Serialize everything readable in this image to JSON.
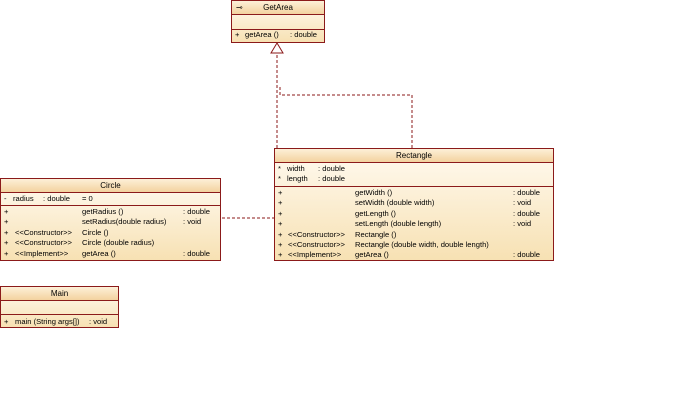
{
  "getarea": {
    "name": "GetArea",
    "icon": "interface-lollipop-icon",
    "icon_glyph": "⊸",
    "methods": [
      {
        "vis": "+",
        "name": "getArea ()",
        "type": ": double"
      }
    ]
  },
  "rectangle": {
    "name": "Rectangle",
    "attributes": [
      {
        "vis": "*",
        "name": "width",
        "type": ": double"
      },
      {
        "vis": "*",
        "name": "length",
        "type": ": double"
      }
    ],
    "methods": [
      {
        "vis": "+",
        "stereo": "",
        "name": "getWidth ()",
        "type": ": double"
      },
      {
        "vis": "+",
        "stereo": "",
        "name": "setWidth (double width)",
        "type": ": void"
      },
      {
        "vis": "+",
        "stereo": "",
        "name": "getLength ()",
        "type": ": double"
      },
      {
        "vis": "+",
        "stereo": "",
        "name": "setLength (double length)",
        "type": ": void"
      },
      {
        "vis": "+",
        "stereo": "<<Constructor>>",
        "name": "Rectangle ()",
        "type": ""
      },
      {
        "vis": "+",
        "stereo": "<<Constructor>>",
        "name": "Rectangle (double width, double length)",
        "type": ""
      },
      {
        "vis": "+",
        "stereo": "<<Implement>>",
        "name": "getArea ()",
        "type": ": double"
      }
    ]
  },
  "circle": {
    "name": "Circle",
    "attributes": [
      {
        "vis": "-",
        "name": "radius",
        "type": ": double",
        "default": "= 0"
      }
    ],
    "methods": [
      {
        "vis": "+",
        "stereo": "",
        "name": "getRadius ()",
        "type": ": double"
      },
      {
        "vis": "+",
        "stereo": "",
        "name": "setRadius(double radius)",
        "type": ": void"
      },
      {
        "vis": "+",
        "stereo": "<<Constructor>>",
        "name": "Circle ()",
        "type": ""
      },
      {
        "vis": "+",
        "stereo": "<<Constructor>>",
        "name": "Circle (double radius)",
        "type": ""
      },
      {
        "vis": "+",
        "stereo": "<<Implement>>",
        "name": "getArea ()",
        "type": ": double"
      }
    ]
  },
  "main": {
    "name": "Main",
    "methods": [
      {
        "vis": "+",
        "name": "main (String args[])",
        "type": ": void"
      }
    ]
  },
  "colors": {
    "border": "#8b1a1a",
    "fill_top": "#fffaf0",
    "fill_bottom": "#f7e1b3",
    "connector": "#8b1a1a"
  }
}
